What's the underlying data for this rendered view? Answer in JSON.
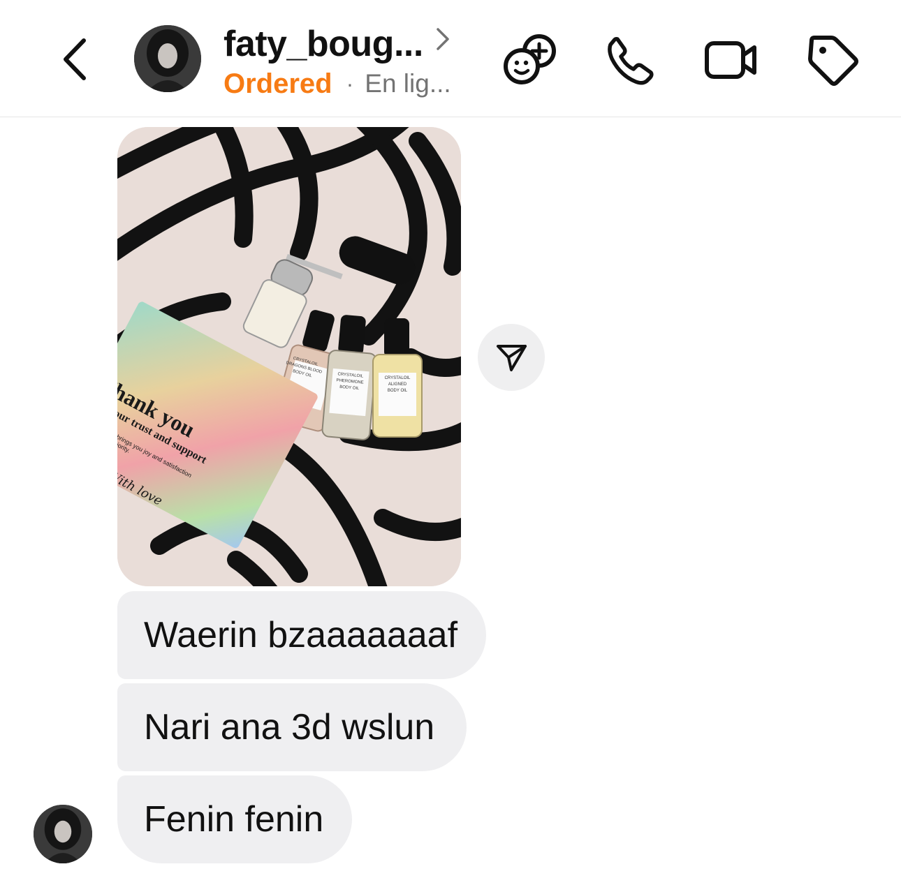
{
  "header": {
    "username": "faty_boug...",
    "label": "Ordered",
    "separator": "·",
    "status": "En lig..."
  },
  "icons": {
    "back": "chevron-left-icon",
    "chevron": "chevron-right-icon",
    "add_effect": "add-effect-icon",
    "call": "phone-icon",
    "video": "video-camera-icon",
    "tag": "tag-icon",
    "share": "send-icon"
  },
  "colors": {
    "label": "#f77b14",
    "bubble": "#efeff1",
    "muted": "#737373"
  },
  "image_card": {
    "title": "Thank you",
    "subtitle": "For your trust and support",
    "body_line1": "e our product brings you joy and satisfaction",
    "body_line2": "piness is our priority.",
    "signature": "With love",
    "bottles": [
      {
        "brand": "CRYSTALOIL",
        "name": "DRAGONS BLOOD",
        "type": "BODY OIL"
      },
      {
        "brand": "CRYSTALOIL",
        "name": "PHEROMONE",
        "type": "BODY OIL"
      },
      {
        "brand": "CRYSTALOIL",
        "name": "ALIGNED",
        "type": "BODY OIL"
      }
    ]
  },
  "messages": [
    {
      "text": "Waerin bzaaaaaaaf"
    },
    {
      "text": "Nari ana 3d wslun"
    },
    {
      "text": "Fenin fenin"
    }
  ]
}
